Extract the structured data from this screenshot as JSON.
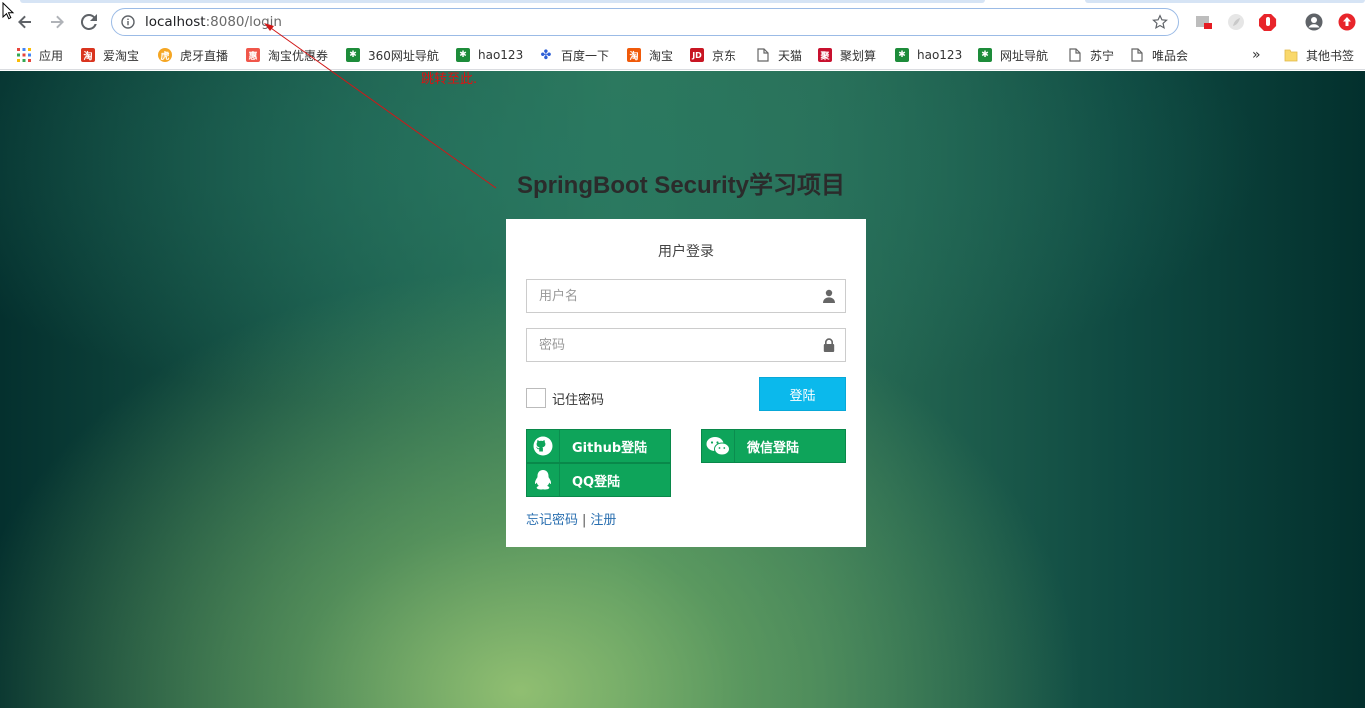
{
  "browser": {
    "url_host": "localhost",
    "url_port": ":8080",
    "url_path": "/login"
  },
  "bookmarks": [
    {
      "label": "应用",
      "icon": "apps-grid-icon",
      "color": "#e8453c"
    },
    {
      "label": "爱淘宝",
      "icon": "aitaobao-icon",
      "color": "#d9341f"
    },
    {
      "label": "虎牙直播",
      "icon": "huya-icon",
      "color": "#f5a623"
    },
    {
      "label": "淘宝优惠券",
      "icon": "coupon-icon",
      "color": "#f0564a"
    },
    {
      "label": "360网址导航",
      "icon": "site-360-icon",
      "color": "#1d8c3a"
    },
    {
      "label": "hao123",
      "icon": "hao123-icon",
      "color": "#1d8c3a"
    },
    {
      "label": "百度一下",
      "icon": "baidu-icon",
      "color": "#2e5fd6"
    },
    {
      "label": "淘宝",
      "icon": "taobao-icon",
      "color": "#f05a0a"
    },
    {
      "label": "京东",
      "icon": "jd-icon",
      "color": "#c81623"
    },
    {
      "label": "天猫",
      "icon": "page-icon",
      "color": "#666666"
    },
    {
      "label": "聚划算",
      "icon": "juhuasuan-icon",
      "color": "#c8102e"
    },
    {
      "label": "hao123",
      "icon": "hao123-icon",
      "color": "#1d8c3a"
    },
    {
      "label": "网址导航",
      "icon": "site-nav-icon",
      "color": "#1d8c3a"
    },
    {
      "label": "苏宁",
      "icon": "page-icon",
      "color": "#666666"
    },
    {
      "label": "唯品会",
      "icon": "page-icon",
      "color": "#666666"
    }
  ],
  "bookmarks_overflow": "»",
  "other_bookmarks": "其他书签",
  "annotation": {
    "text": "跳转至此."
  },
  "page": {
    "title": "SpringBoot Security学习项目"
  },
  "login": {
    "heading": "用户登录",
    "username_placeholder": "用户名",
    "password_placeholder": "密码",
    "remember_label": "记住密码",
    "submit_label": "登陆",
    "github_label": "Github登陆",
    "wechat_label": "微信登陆",
    "qq_label": "QQ登陆",
    "forgot_label": "忘记密码",
    "separator": "|",
    "register_label": "注册"
  },
  "colors": {
    "login_button": "#0bb9ec",
    "social_button": "#0ea45a",
    "link": "#2a6fb0",
    "annotation": "#e01010"
  }
}
